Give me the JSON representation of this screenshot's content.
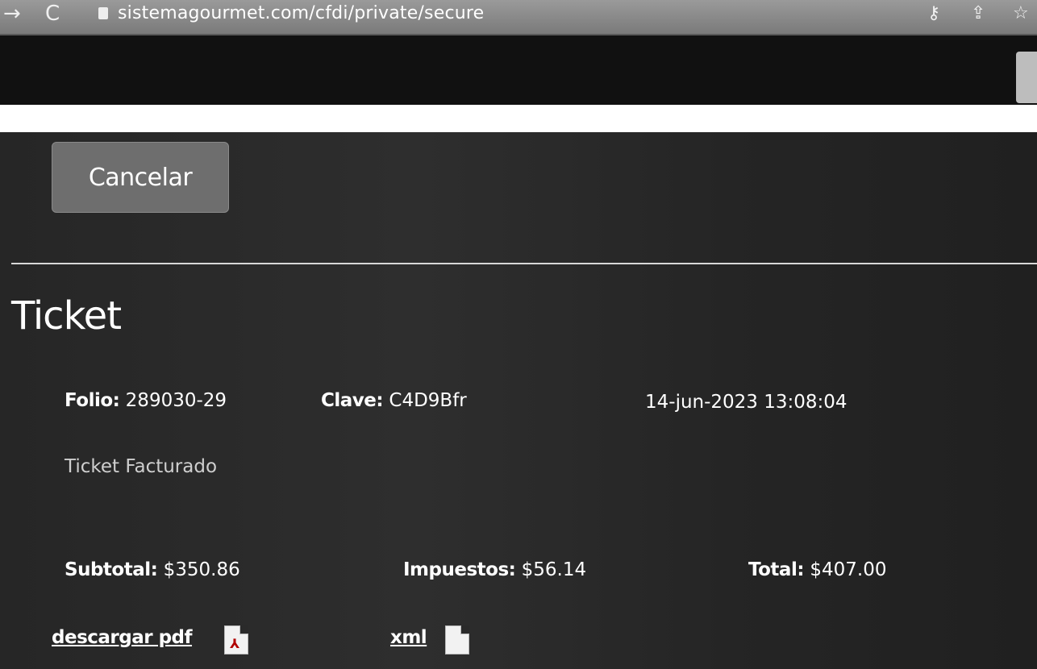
{
  "browser": {
    "back_glyph": "→",
    "reload_glyph": "C",
    "url": "sistemagourmet.com/cfdi/private/secure",
    "key_glyph": "⚷",
    "share_glyph": "⇪",
    "star_glyph": "☆"
  },
  "toolbar": {
    "cancel_label": "Cancelar"
  },
  "ticket": {
    "title": "Ticket",
    "folio_label": "Folio:",
    "folio_value": "289030-29",
    "clave_label": "Clave:",
    "clave_value": "C4D9Bfr",
    "datetime": "14-jun-2023 13:08:04",
    "status": "Ticket Facturado",
    "subtotal_label": "Subtotal:",
    "subtotal_value": "$350.86",
    "impuestos_label": "Impuestos:",
    "impuestos_value": "$56.14",
    "total_label": "Total:",
    "total_value": "$407.00",
    "pdf_link": "descargar pdf",
    "xml_link": "xml"
  },
  "colors": {
    "panel_bg": "#2a2a2a",
    "button_bg": "#6e6e6e",
    "text": "#ffffff"
  },
  "icons": [
    "back-icon",
    "reload-icon",
    "lock-icon",
    "key-icon",
    "share-icon",
    "star-icon",
    "pdf-file-icon",
    "xml-file-icon"
  ]
}
